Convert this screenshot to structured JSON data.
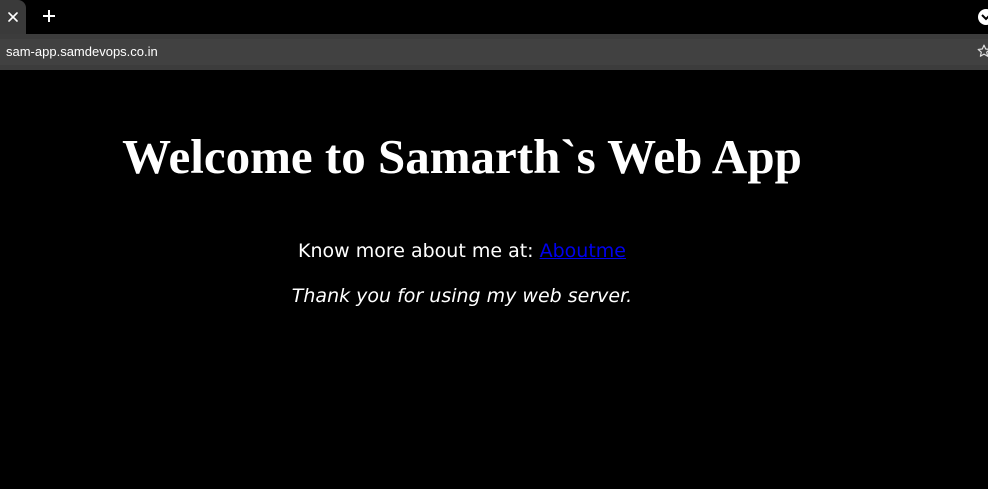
{
  "browser": {
    "address_bar": {
      "url": "sam-app.samdevops.co.in"
    },
    "icons": {
      "tab_close": "close-icon",
      "new_tab": "plus-icon",
      "bookmark": "star-icon",
      "menu": "chevron-down-icon"
    }
  },
  "page": {
    "heading": "Welcome to Samarth`s Web App",
    "know_more_text": "Know more about me at: ",
    "link_label": "Aboutme",
    "thanks_text": "Thank you for using my web server."
  },
  "colors": {
    "page_background": "#000000",
    "text": "#ffffff",
    "link": "#0000ee",
    "toolbar": "#3c3c3c"
  }
}
